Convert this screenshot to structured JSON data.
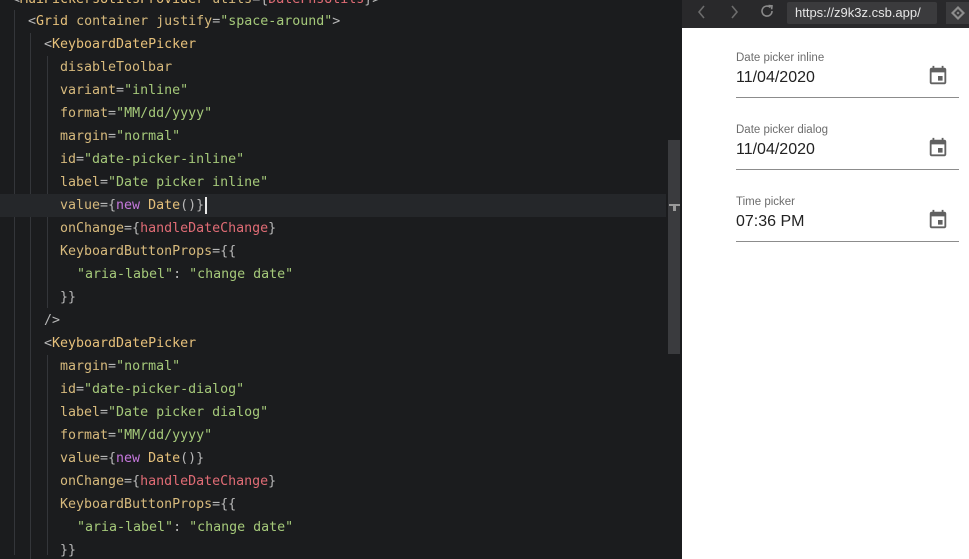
{
  "editor": {
    "lines": [
      {
        "segments": [
          [
            "<",
            "p"
          ],
          [
            "MuiPickersUtilsProvider",
            "tag"
          ],
          [
            " ",
            ""
          ],
          [
            "utils",
            "attr"
          ],
          [
            "={",
            "p"
          ],
          [
            "DateFnsUtils",
            "red"
          ],
          [
            "}>",
            "p"
          ]
        ]
      },
      {
        "segments": [
          [
            "<",
            "p"
          ],
          [
            "Grid",
            "tag"
          ],
          [
            " ",
            ""
          ],
          [
            "container",
            "attr"
          ],
          [
            " ",
            ""
          ],
          [
            "justify",
            "attr"
          ],
          [
            "=",
            "p"
          ],
          [
            "\"space-around\"",
            "str"
          ],
          [
            ">",
            "p"
          ]
        ]
      },
      {
        "segments": [
          [
            "<",
            "p"
          ],
          [
            "KeyboardDatePicker",
            "tag"
          ]
        ]
      },
      {
        "segments": [
          [
            "disableToolbar",
            "attr"
          ]
        ]
      },
      {
        "segments": [
          [
            "variant",
            "attr"
          ],
          [
            "=",
            "p"
          ],
          [
            "\"inline\"",
            "str"
          ]
        ]
      },
      {
        "segments": [
          [
            "format",
            "attr"
          ],
          [
            "=",
            "p"
          ],
          [
            "\"MM/dd/yyyy\"",
            "str"
          ]
        ]
      },
      {
        "segments": [
          [
            "margin",
            "attr"
          ],
          [
            "=",
            "p"
          ],
          [
            "\"normal\"",
            "str"
          ]
        ]
      },
      {
        "segments": [
          [
            "id",
            "attr"
          ],
          [
            "=",
            "p"
          ],
          [
            "\"date-picker-inline\"",
            "str"
          ]
        ]
      },
      {
        "segments": [
          [
            "label",
            "attr"
          ],
          [
            "=",
            "p"
          ],
          [
            "\"Date picker inline\"",
            "str"
          ]
        ]
      },
      {
        "segments": [
          [
            "value",
            "attr"
          ],
          [
            "={",
            "p"
          ],
          [
            "new",
            "kw"
          ],
          [
            " ",
            ""
          ],
          [
            "Date",
            "fn"
          ],
          [
            "()}",
            "p"
          ]
        ],
        "active": true,
        "caret": true
      },
      {
        "segments": [
          [
            "onChange",
            "attr"
          ],
          [
            "={",
            "p"
          ],
          [
            "handleDateChange",
            "red"
          ],
          [
            "}",
            "p"
          ]
        ]
      },
      {
        "segments": [
          [
            "KeyboardButtonProps",
            "attr"
          ],
          [
            "={{",
            "p"
          ]
        ]
      },
      {
        "segments": [
          [
            "\"aria-label\"",
            "str"
          ],
          [
            ": ",
            "p"
          ],
          [
            "\"change date\"",
            "str"
          ]
        ]
      },
      {
        "segments": [
          [
            "}}",
            "p"
          ]
        ]
      },
      {
        "segments": [
          [
            "/>",
            "p"
          ]
        ]
      },
      {
        "segments": [
          [
            "<",
            "p"
          ],
          [
            "KeyboardDatePicker",
            "tag"
          ]
        ]
      },
      {
        "segments": [
          [
            "margin",
            "attr"
          ],
          [
            "=",
            "p"
          ],
          [
            "\"normal\"",
            "str"
          ]
        ]
      },
      {
        "segments": [
          [
            "id",
            "attr"
          ],
          [
            "=",
            "p"
          ],
          [
            "\"date-picker-dialog\"",
            "str"
          ]
        ]
      },
      {
        "segments": [
          [
            "label",
            "attr"
          ],
          [
            "=",
            "p"
          ],
          [
            "\"Date picker dialog\"",
            "str"
          ]
        ]
      },
      {
        "segments": [
          [
            "format",
            "attr"
          ],
          [
            "=",
            "p"
          ],
          [
            "\"MM/dd/yyyy\"",
            "str"
          ]
        ]
      },
      {
        "segments": [
          [
            "value",
            "attr"
          ],
          [
            "={",
            "p"
          ],
          [
            "new",
            "kw"
          ],
          [
            " ",
            ""
          ],
          [
            "Date",
            "fn"
          ],
          [
            "()}",
            "p"
          ]
        ]
      },
      {
        "segments": [
          [
            "onChange",
            "attr"
          ],
          [
            "={",
            "p"
          ],
          [
            "handleDateChange",
            "red"
          ],
          [
            "}",
            "p"
          ]
        ]
      },
      {
        "segments": [
          [
            "KeyboardButtonProps",
            "attr"
          ],
          [
            "={{",
            "p"
          ]
        ]
      },
      {
        "segments": [
          [
            "\"aria-label\"",
            "str"
          ],
          [
            ": ",
            "p"
          ],
          [
            "\"change date\"",
            "str"
          ]
        ]
      },
      {
        "segments": [
          [
            "}}",
            "p"
          ]
        ]
      }
    ]
  },
  "browser": {
    "back_icon": "chevron-left-icon",
    "forward_icon": "chevron-right-icon",
    "reload_icon": "reload-icon",
    "url": "https://z9k3z.csb.app/",
    "extension_icon": "codesandbox-icon"
  },
  "preview": {
    "fields": [
      {
        "label": "Date picker inline",
        "value": "11/04/2020",
        "icon": "calendar-icon"
      },
      {
        "label": "Date picker dialog",
        "value": "11/04/2020",
        "icon": "calendar-icon"
      },
      {
        "label": "Time picker",
        "value": "07:36 PM",
        "icon": "calendar-icon"
      }
    ]
  },
  "colors": {
    "editor_bg": "#1b1c1e",
    "string": "#a5c97a",
    "keyword": "#c678dd",
    "tag": "#e6c07b",
    "variable": "#e07c6c",
    "browser_bar": "#29292b"
  }
}
